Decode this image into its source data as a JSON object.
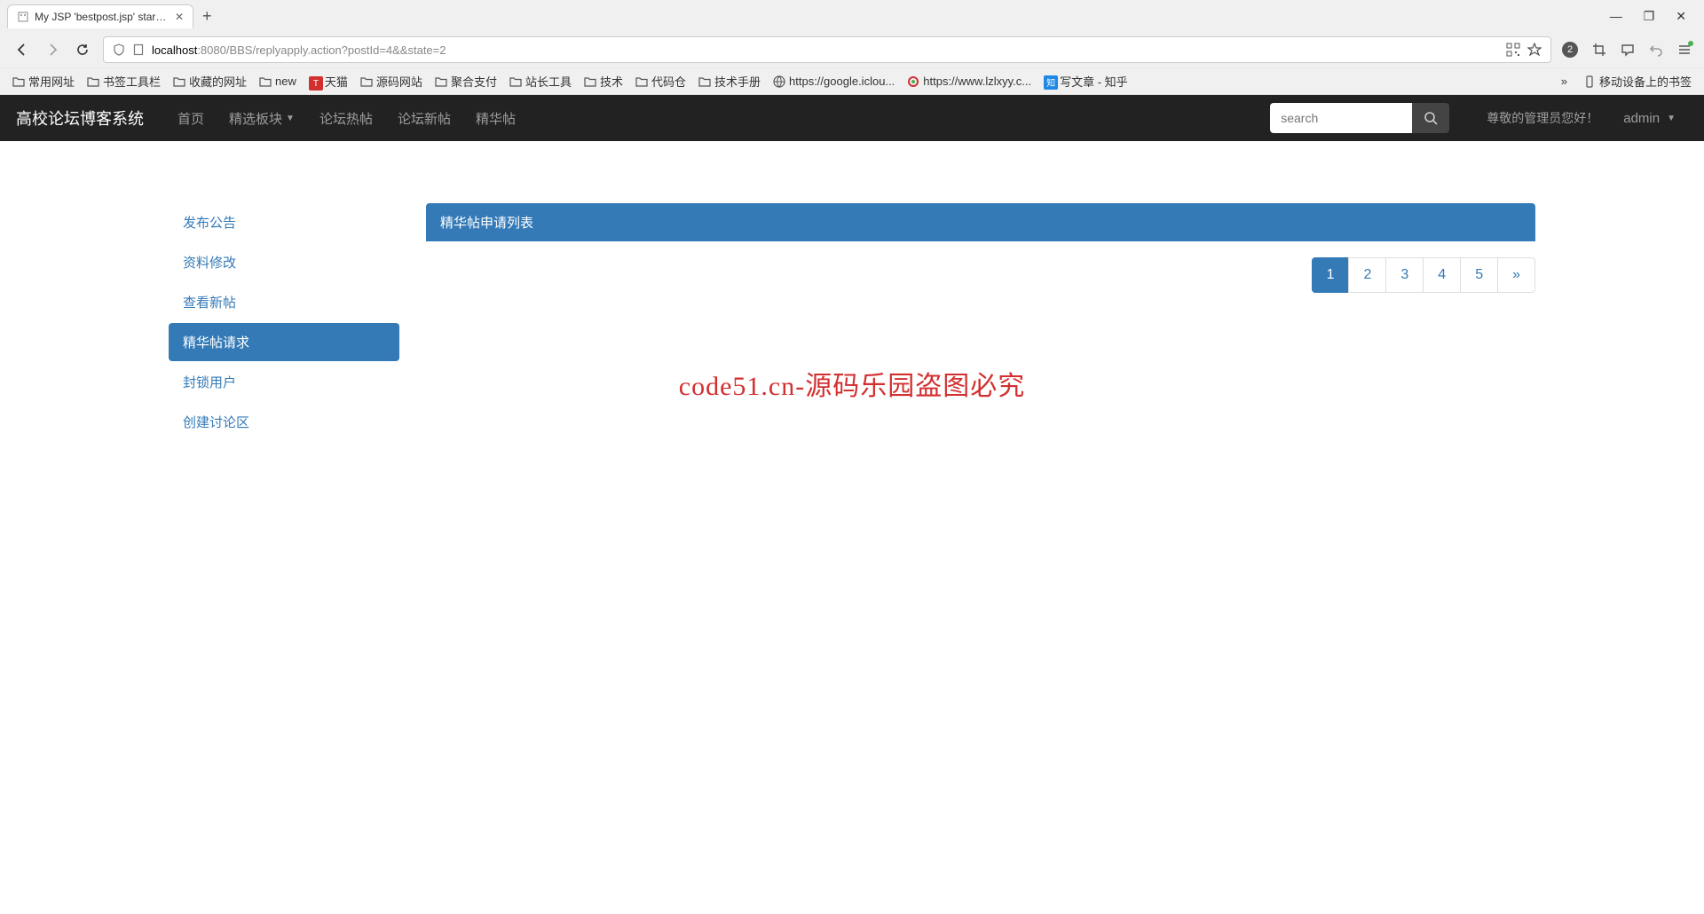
{
  "browser": {
    "tab_title": "My JSP 'bestpost.jsp' starting",
    "url_host": "localhost",
    "url_port_path": ":8080/BBS/replyapply.action?postId=4&&state=2",
    "badge_count": "2",
    "bookmarks": [
      {
        "label": "常用网址",
        "type": "folder"
      },
      {
        "label": "书签工具栏",
        "type": "folder"
      },
      {
        "label": "收藏的网址",
        "type": "folder"
      },
      {
        "label": "new",
        "type": "folder"
      },
      {
        "label": "天猫",
        "type": "badge-red",
        "badge": "T"
      },
      {
        "label": "源码网站",
        "type": "folder"
      },
      {
        "label": "聚合支付",
        "type": "folder"
      },
      {
        "label": "站长工具",
        "type": "folder"
      },
      {
        "label": "技术",
        "type": "folder"
      },
      {
        "label": "代码仓",
        "type": "folder"
      },
      {
        "label": "技术手册",
        "type": "folder"
      },
      {
        "label": "https://google.iclou...",
        "type": "globe"
      },
      {
        "label": "https://www.lzlxyy.c...",
        "type": "circle"
      },
      {
        "label": "写文章 - 知乎",
        "type": "badge-blue",
        "badge": "知"
      }
    ],
    "mobile_bookmark": "移动设备上的书签"
  },
  "navbar": {
    "brand": "高校论坛博客系统",
    "items": [
      "首页",
      "精选板块",
      "论坛热帖",
      "论坛新帖",
      "精华帖"
    ],
    "search_placeholder": "search",
    "greeting": "尊敬的管理员您好！",
    "user": "admin"
  },
  "sidebar": {
    "items": [
      {
        "label": "发布公告",
        "active": false
      },
      {
        "label": "资料修改",
        "active": false
      },
      {
        "label": "查看新帖",
        "active": false
      },
      {
        "label": "精华帖请求",
        "active": true
      },
      {
        "label": "封锁用户",
        "active": false
      },
      {
        "label": "创建讨论区",
        "active": false
      }
    ]
  },
  "panel": {
    "header": "精华帖申请列表"
  },
  "pagination": {
    "pages": [
      "1",
      "2",
      "3",
      "4",
      "5"
    ],
    "next": "»",
    "active": "1"
  },
  "watermark": "code51.cn-源码乐园盗图必究"
}
